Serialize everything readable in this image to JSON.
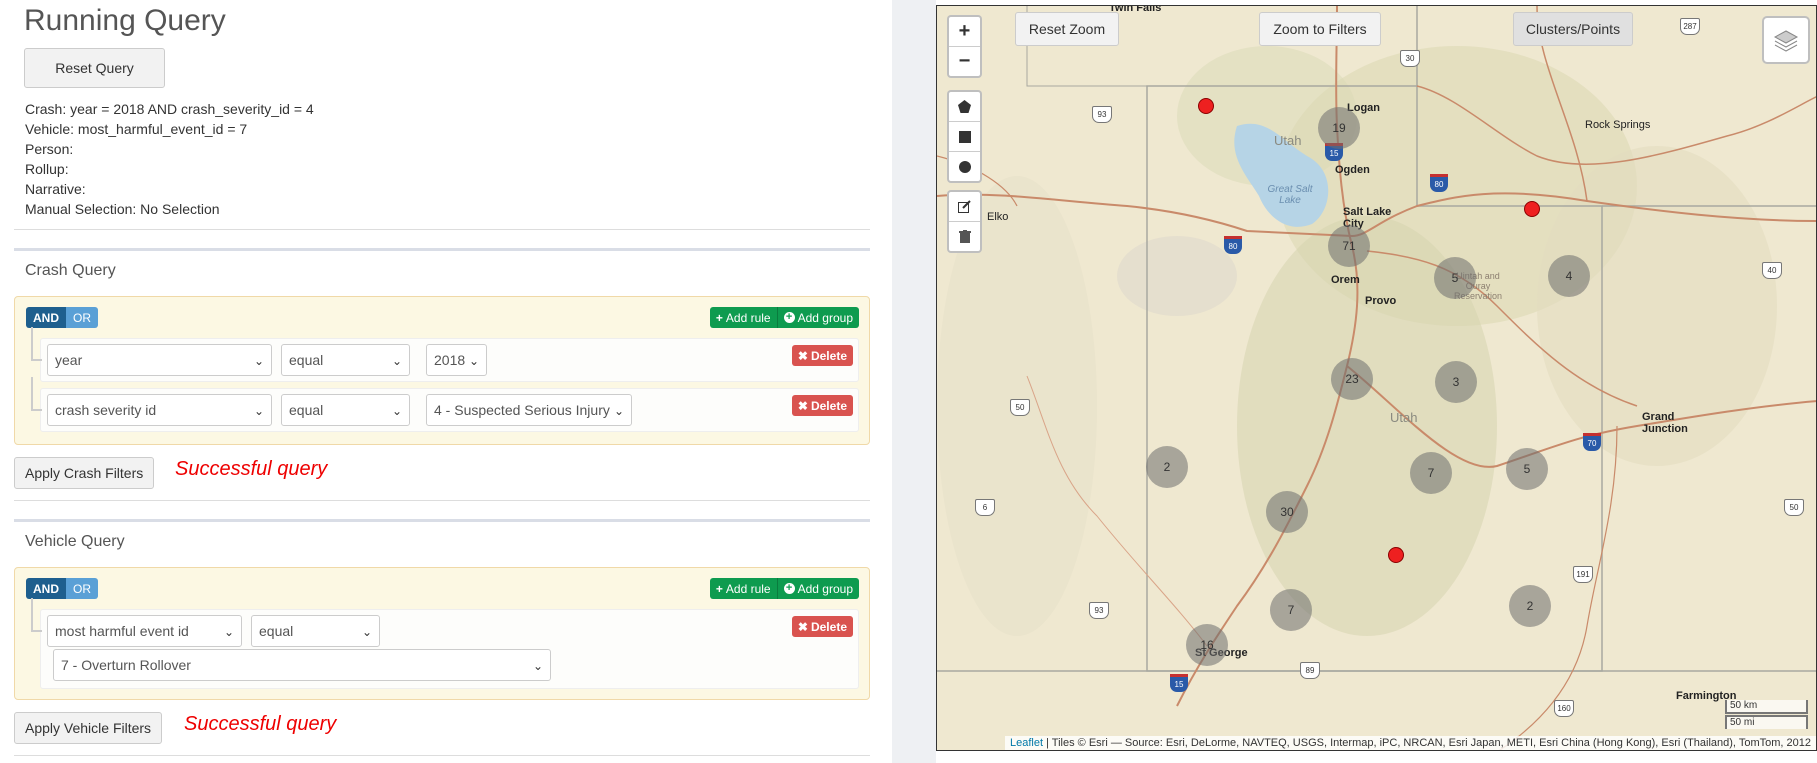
{
  "left": {
    "title": "Running Query",
    "reset_label": "Reset Query",
    "summary": [
      "Crash: year = 2018 AND crash_severity_id = 4",
      "Vehicle: most_harmful_event_id = 7",
      "Person:",
      "Rollup:",
      "Narrative:",
      "Manual Selection: No Selection"
    ],
    "crash": {
      "title": "Crash Query",
      "and": "AND",
      "or": "OR",
      "add_rule": "Add rule",
      "add_group": "Add group",
      "delete": "Delete",
      "rules": [
        {
          "field": "year",
          "op": "equal",
          "value": "2018"
        },
        {
          "field": "crash severity id",
          "op": "equal",
          "value": "4 - Suspected Serious Injury"
        }
      ],
      "apply": "Apply Crash Filters",
      "status": "Successful query"
    },
    "vehicle": {
      "title": "Vehicle Query",
      "and": "AND",
      "or": "OR",
      "add_rule": "Add rule",
      "add_group": "Add group",
      "delete": "Delete",
      "rule": {
        "field": "most harmful event id",
        "op": "equal",
        "value": "7 - Overturn Rollover"
      },
      "apply": "Apply Vehicle Filters",
      "status": "Successful query"
    }
  },
  "map": {
    "buttons": {
      "reset_zoom": "Reset Zoom",
      "zoom_filters": "Zoom to Filters",
      "clusters": "Clusters/Points"
    },
    "zoom": {
      "in": "+",
      "out": "−"
    },
    "icons": [
      "polygon-draw-icon",
      "rectangle-draw-icon",
      "circle-draw-icon",
      "edit-icon",
      "trash-icon",
      "layers-icon"
    ],
    "clusters": [
      "19",
      "71",
      "5",
      "4",
      "23",
      "3",
      "2",
      "7",
      "5",
      "30",
      "7",
      "2",
      "16"
    ],
    "labels": {
      "twin": "Twin Falls",
      "logan": "Logan",
      "ogden": "Ogden",
      "slc": "Salt Lake City",
      "orem": "Orem",
      "provo": "Provo",
      "elko": "Elko",
      "rock": "Rock Springs",
      "gj": "Grand Junction",
      "sg": "St George",
      "farm": "Farmington",
      "utah1": "Utah",
      "utah2": "Utah",
      "lake": "Great Salt Lake",
      "res": "Uintah and Ouray Reservation"
    },
    "shields": [
      "93",
      "15",
      "30",
      "80",
      "287",
      "40",
      "50",
      "6",
      "93",
      "89",
      "15",
      "160",
      "191",
      "70",
      "50",
      "80"
    ],
    "scale": {
      "km": "50 km",
      "mi": "50 mi"
    },
    "attribution": {
      "link": "Leaflet",
      "text": " | Tiles © Esri — Source: Esri, DeLorme, NAVTEQ, USGS, Intermap, iPC, NRCAN, Esri Japan, METI, Esri China (Hong Kong), Esri (Thailand), TomTom, 2012"
    },
    "colors": {
      "cluster": "#6e6e6e",
      "point": "#ee2020",
      "terrain": "#efe8d0"
    }
  }
}
